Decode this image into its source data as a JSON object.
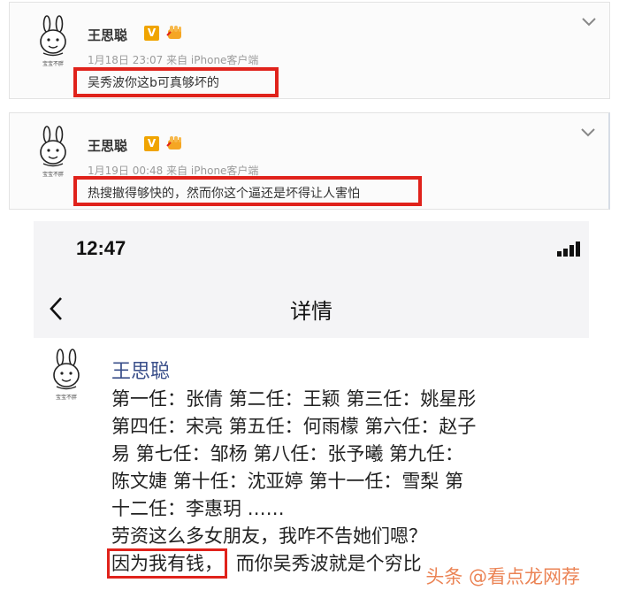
{
  "posts": [
    {
      "avatar_caption": "宝宝不胖",
      "username": "王思聪",
      "vip_badge": "V",
      "meta": "1月18日 23:07 来自 iPhone客户端",
      "text": "吴秀波你这b可真够坏的"
    },
    {
      "avatar_caption": "宝宝不胖",
      "username": "王思聪",
      "vip_badge": "V",
      "meta": "1月19日 00:48 来自 iPhone客户端",
      "text": "热搜撤得够快的，然而你这个逼还是坏得让人害怕"
    }
  ],
  "phone": {
    "time": "12:47",
    "network": "4G",
    "nav_title": "详情",
    "avatar_caption": "宝宝不胖",
    "author": "王思聪",
    "lines": [
      "第一任：张倩 第二任：王颖 第三任：姚星彤",
      "第四任：宋亮 第五任：何雨檬 第六任：赵子",
      "易 第七任：邹杨 第八任：张予曦 第九任：",
      "陈文婕 第十任：沈亚婷 第十一任：雪梨 第",
      "十二任：李惠玥 ……",
      "劳资这么多女朋友，我咋不告她们嗯？"
    ],
    "last_line_boxed": "因为我有钱，",
    "last_line_rest": "而你吴秀波就是个穷比"
  },
  "watermark": "头条 @看点龙网荐",
  "colors": {
    "highlight": "#e0221b",
    "vip_badge": "#f0a400",
    "author_link": "#3a4f8a"
  },
  "icons": [
    "rabbit-avatar-icon",
    "fist-icon",
    "chevron-down-icon",
    "signal-icon",
    "battery-icon",
    "back-arrow-icon"
  ]
}
